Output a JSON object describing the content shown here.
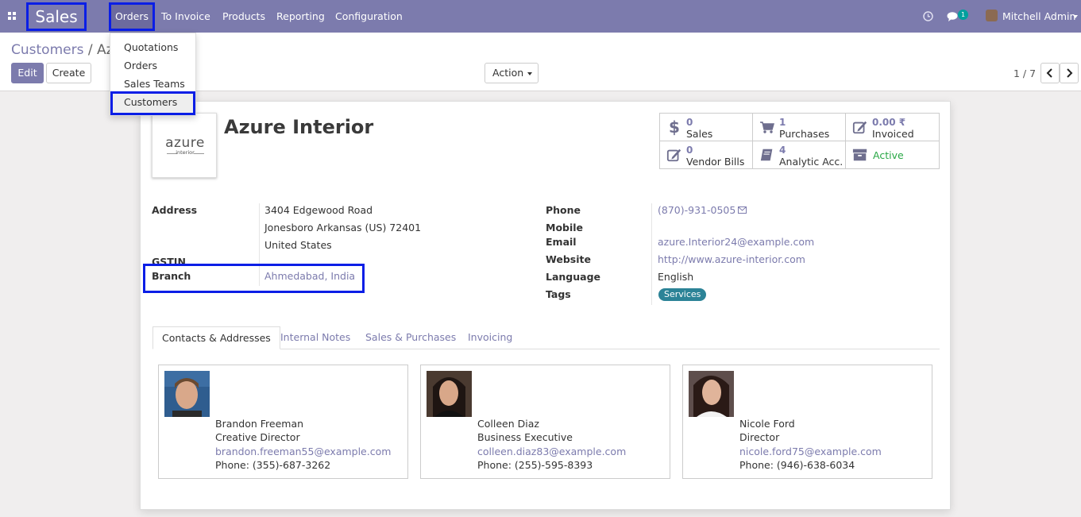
{
  "navbar": {
    "app_title": "Sales",
    "menus": [
      "Orders",
      "To Invoice",
      "Products",
      "Reporting",
      "Configuration"
    ],
    "messages_badge": "1",
    "user_name": "Mitchell Admin"
  },
  "dropdown": {
    "items": [
      "Quotations",
      "Orders",
      "Sales Teams",
      "Customers"
    ]
  },
  "control": {
    "breadcrumb_parent": "Customers",
    "breadcrumb_separator": " / ",
    "breadcrumb_current": "Az",
    "edit_label": "Edit",
    "create_label": "Create",
    "action_label": "Action",
    "pager": "1 / 7"
  },
  "record": {
    "name": "Azure Interior",
    "logo_main": "azure",
    "logo_sub": "interior"
  },
  "stats": [
    {
      "icon": "dollar-icon",
      "num": "0",
      "label": "Sales"
    },
    {
      "icon": "cart-icon",
      "num": "1",
      "label": "Purchases"
    },
    {
      "icon": "edit-icon",
      "num": "0.00 ₹",
      "label": "Invoiced"
    },
    {
      "icon": "edit-icon",
      "num": "0",
      "label": "Vendor Bills"
    },
    {
      "icon": "book-icon",
      "num": "4",
      "label": "Analytic Acc..."
    },
    {
      "icon": "archive-icon",
      "num": "",
      "label": "Active"
    }
  ],
  "fields_left": {
    "address_label": "Address",
    "address_line1": "3404 Edgewood Road",
    "address_line2": "Jonesboro  Arkansas (US)  72401",
    "address_line3": "United States",
    "gstin_label": "GSTIN",
    "branch_label": "Branch",
    "branch_value": "Ahmedabad, India"
  },
  "fields_right": {
    "phone_label": "Phone",
    "phone_value": "(870)-931-0505",
    "mobile_label": "Mobile",
    "email_label": "Email",
    "email_value": "azure.Interior24@example.com",
    "website_label": "Website",
    "website_value": "http://www.azure-interior.com",
    "language_label": "Language",
    "language_value": "English",
    "tags_label": "Tags",
    "tag_value": "Services"
  },
  "tabs": [
    "Contacts & Addresses",
    "Internal Notes",
    "Sales & Purchases",
    "Invoicing"
  ],
  "contacts": [
    {
      "name": "Brandon Freeman",
      "title": "Creative Director",
      "email": "brandon.freeman55@example.com",
      "phone": "Phone: (355)-687-3262"
    },
    {
      "name": "Colleen Diaz",
      "title": "Business Executive",
      "email": "colleen.diaz83@example.com",
      "phone": "Phone: (255)-595-8393"
    },
    {
      "name": "Nicole Ford",
      "title": "Director",
      "email": "nicole.ford75@example.com",
      "phone": "Phone: (946)-638-6034"
    }
  ],
  "colors": {
    "navbar": "#7c7bad",
    "link": "#7c7bad",
    "highlight_box": "#0a1ee6",
    "active_green": "#28a745",
    "tag": "#2c8397"
  }
}
